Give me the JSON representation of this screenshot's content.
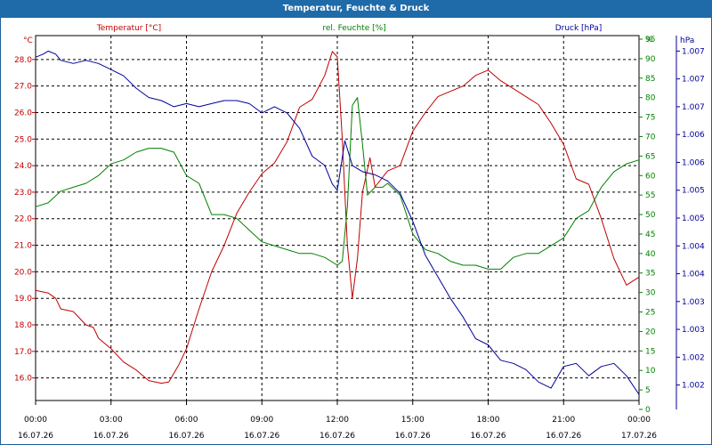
{
  "window": {
    "title": "Temperatur, Feuchte & Druck"
  },
  "colors": {
    "temperature": "#c00000",
    "humidity": "#008000",
    "pressure": "#000099",
    "grid": "#000000",
    "titlebar": "#1f6aa8"
  },
  "chart_data": {
    "type": "line",
    "title": "Temperatur, Feuchte & Druck",
    "grid": true,
    "x_ticks": [
      {
        "time": "00:00",
        "date": "16.07.26"
      },
      {
        "time": "03:00",
        "date": "16.07.26"
      },
      {
        "time": "06:00",
        "date": "16.07.26"
      },
      {
        "time": "09:00",
        "date": "16.07.26"
      },
      {
        "time": "12:00",
        "date": "16.07.26"
      },
      {
        "time": "15:00",
        "date": "16.07.26"
      },
      {
        "time": "18:00",
        "date": "16.07.26"
      },
      {
        "time": "21:00",
        "date": "16.07.26"
      },
      {
        "time": "00:00",
        "date": "17.07.26"
      }
    ],
    "xlim_hours": [
      0,
      24
    ],
    "axes": {
      "temperature": {
        "label": "Temperatur [°C]",
        "unit": "°C",
        "side": "left",
        "ylim": [
          15.15,
          28.9
        ],
        "ticks": [
          "16.0",
          "17.0",
          "18.0",
          "19.0",
          "20.0",
          "21.0",
          "22.0",
          "23.0",
          "24.0",
          "25.0",
          "26.0",
          "27.0",
          "28.0"
        ]
      },
      "humidity": {
        "label": "rel. Feuchte [%]",
        "unit": "%",
        "side": "right",
        "ylim": [
          0,
          95
        ],
        "ticks": [
          "0",
          "5",
          "10",
          "15",
          "20",
          "25",
          "30",
          "35",
          "40",
          "45",
          "50",
          "55",
          "60",
          "65",
          "70",
          "75",
          "80",
          "85",
          "90",
          "95",
          "%"
        ]
      },
      "pressure": {
        "label": "Druck [hPa]",
        "unit": "hPa",
        "side": "right-outer",
        "ylim": [
          1001.7,
          1007.6
        ],
        "ticks": [
          "1.002",
          "1.002",
          "1.003",
          "1.003",
          "1.004",
          "1.004",
          "1.005",
          "1.005",
          "1.006",
          "1.006",
          "1.007",
          "1.007",
          "1.007"
        ],
        "tick_values": [
          1001.95,
          1002.4,
          1002.85,
          1003.3,
          1003.75,
          1004.2,
          1004.65,
          1005.1,
          1005.55,
          1006.0,
          1006.45,
          1006.9,
          1007.35
        ]
      }
    },
    "series": [
      {
        "name": "Temperatur [°C]",
        "axis": "temperature",
        "color": "#c00000",
        "x": [
          0,
          0.5,
          0.8,
          1.0,
          1.5,
          2.0,
          2.3,
          2.5,
          3.0,
          3.5,
          4.0,
          4.5,
          5.0,
          5.3,
          5.7,
          6.0,
          6.5,
          7.0,
          7.5,
          8.0,
          8.5,
          9.0,
          9.5,
          10.0,
          10.5,
          11.0,
          11.5,
          11.8,
          12.0,
          12.2,
          12.4,
          12.6,
          12.8,
          13.0,
          13.3,
          13.5,
          14.0,
          14.5,
          15.0,
          15.5,
          16.0,
          16.5,
          17.0,
          17.5,
          18.0,
          18.5,
          19.0,
          19.5,
          20.0,
          20.5,
          21.0,
          21.5,
          22.0,
          22.5,
          23.0,
          23.5,
          24.0
        ],
        "y": [
          19.3,
          19.2,
          19.0,
          18.6,
          18.5,
          18.0,
          17.9,
          17.5,
          17.1,
          16.6,
          16.3,
          15.9,
          15.8,
          15.85,
          16.5,
          17.1,
          18.6,
          20.0,
          21.0,
          22.2,
          23.0,
          23.7,
          24.1,
          24.9,
          26.2,
          26.5,
          27.4,
          28.3,
          28.1,
          25.0,
          21.0,
          19.0,
          20.5,
          23.0,
          24.3,
          23.2,
          23.8,
          24.0,
          25.3,
          26.0,
          26.6,
          26.8,
          27.0,
          27.4,
          27.6,
          27.2,
          26.9,
          26.6,
          26.3,
          25.6,
          24.8,
          23.5,
          23.3,
          22.0,
          20.5,
          19.5,
          19.8
        ]
      },
      {
        "name": "rel. Feuchte [%]",
        "axis": "humidity",
        "color": "#008000",
        "x": [
          0,
          0.5,
          1.0,
          1.5,
          2.0,
          2.5,
          3.0,
          3.5,
          4.0,
          4.5,
          5.0,
          5.5,
          6.0,
          6.5,
          7.0,
          7.5,
          8.0,
          8.5,
          9.0,
          9.5,
          10.0,
          10.5,
          11.0,
          11.5,
          12.0,
          12.2,
          12.4,
          12.6,
          12.8,
          13.0,
          13.2,
          13.5,
          13.8,
          14.0,
          14.5,
          15.0,
          15.5,
          16.0,
          16.5,
          17.0,
          17.5,
          18.0,
          18.5,
          19.0,
          19.5,
          20.0,
          20.5,
          21.0,
          21.5,
          22.0,
          22.5,
          23.0,
          23.5,
          24.0
        ],
        "y": [
          52,
          53,
          56,
          57,
          58,
          60,
          63,
          64,
          66,
          67,
          67,
          66,
          60,
          58,
          50,
          50,
          49,
          46,
          43,
          42,
          41,
          40,
          40,
          39,
          37,
          38,
          52,
          78,
          80,
          68,
          55,
          57,
          57,
          58,
          55,
          45,
          41,
          40,
          38,
          37,
          37,
          36,
          36,
          39,
          40,
          40,
          42,
          44,
          49,
          51,
          57,
          61,
          63,
          64
        ]
      },
      {
        "name": "Druck [hPa]",
        "axis": "pressure",
        "color": "#000099",
        "x": [
          0,
          0.3,
          0.5,
          0.8,
          1.0,
          1.5,
          2.0,
          2.5,
          3.0,
          3.5,
          4.0,
          4.5,
          5.0,
          5.5,
          6.0,
          6.5,
          7.0,
          7.5,
          8.0,
          8.5,
          9.0,
          9.5,
          10.0,
          10.5,
          11.0,
          11.5,
          11.8,
          12.0,
          12.3,
          12.6,
          13.0,
          13.5,
          14.0,
          14.5,
          15.0,
          15.5,
          16.0,
          16.5,
          17.0,
          17.5,
          18.0,
          18.5,
          19.0,
          19.5,
          20.0,
          20.5,
          21.0,
          21.5,
          22.0,
          22.5,
          23.0,
          23.5,
          24.0
        ],
        "y": [
          1007.25,
          1007.3,
          1007.35,
          1007.3,
          1007.2,
          1007.15,
          1007.2,
          1007.15,
          1007.05,
          1006.95,
          1006.75,
          1006.6,
          1006.55,
          1006.45,
          1006.5,
          1006.45,
          1006.5,
          1006.55,
          1006.55,
          1006.5,
          1006.35,
          1006.45,
          1006.35,
          1006.1,
          1005.65,
          1005.5,
          1005.2,
          1005.1,
          1005.9,
          1005.5,
          1005.4,
          1005.35,
          1005.25,
          1005.05,
          1004.6,
          1004.05,
          1003.7,
          1003.35,
          1003.05,
          1002.7,
          1002.6,
          1002.35,
          1002.3,
          1002.2,
          1002.0,
          1001.9,
          1002.25,
          1002.3,
          1002.1,
          1002.25,
          1002.3,
          1002.1,
          1001.8
        ]
      }
    ]
  }
}
